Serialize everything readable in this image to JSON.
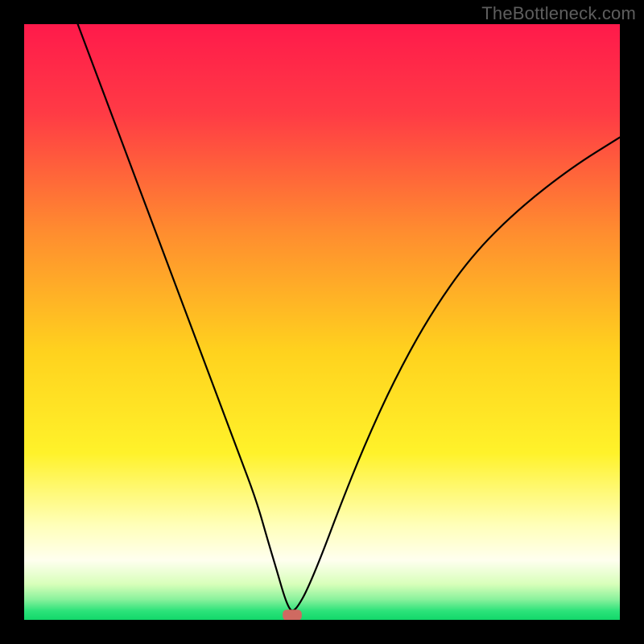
{
  "watermark": "TheBottleneck.com",
  "chart_data": {
    "type": "line",
    "title": "",
    "xlabel": "",
    "ylabel": "",
    "xlim": [
      0,
      100
    ],
    "ylim": [
      0,
      100
    ],
    "grid": false,
    "background_gradient": {
      "stops": [
        {
          "pos": 0.0,
          "color": "#ff1a4b"
        },
        {
          "pos": 0.15,
          "color": "#ff3b45"
        },
        {
          "pos": 0.35,
          "color": "#ff8d2f"
        },
        {
          "pos": 0.55,
          "color": "#ffd21e"
        },
        {
          "pos": 0.72,
          "color": "#fff22a"
        },
        {
          "pos": 0.84,
          "color": "#ffffb8"
        },
        {
          "pos": 0.9,
          "color": "#ffffef"
        },
        {
          "pos": 0.94,
          "color": "#d8ffba"
        },
        {
          "pos": 0.965,
          "color": "#8cf29d"
        },
        {
          "pos": 0.985,
          "color": "#2ce37a"
        },
        {
          "pos": 1.0,
          "color": "#12d86a"
        }
      ]
    },
    "series": [
      {
        "name": "curve",
        "color": "#000000",
        "stroke_width": 2.2,
        "x": [
          9,
          12,
          15,
          18,
          21,
          24,
          27,
          30,
          33,
          36,
          39,
          41,
          42.5,
          43.5,
          44.3,
          45,
          46,
          47.5,
          50,
          53,
          57,
          62,
          68,
          75,
          83,
          92,
          100
        ],
        "y": [
          100,
          92,
          84,
          76,
          68,
          60,
          52,
          44,
          36,
          28,
          20,
          13,
          8,
          4.5,
          2.3,
          1.3,
          2.3,
          5,
          11,
          19,
          29,
          40,
          51,
          61,
          69,
          76,
          81
        ]
      }
    ],
    "marker": {
      "name": "bottleneck-marker",
      "shape": "rounded-rect",
      "x": 45,
      "y": 0.8,
      "width": 3.2,
      "height": 1.8,
      "color": "#cf6a61"
    }
  }
}
